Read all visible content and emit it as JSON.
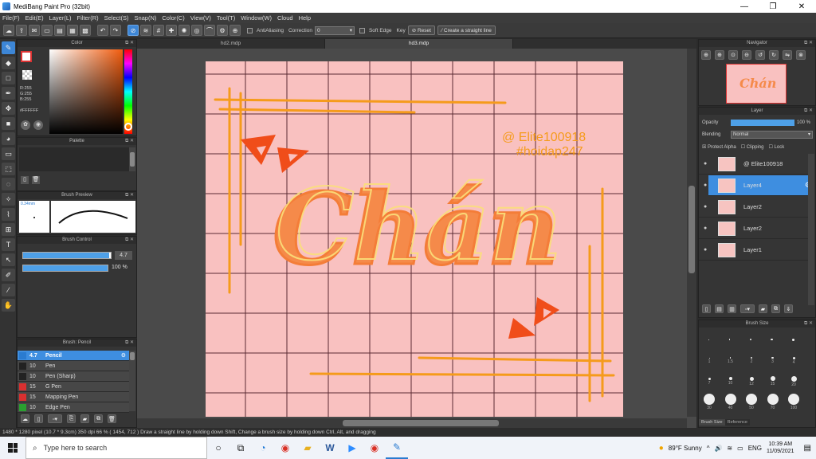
{
  "window": {
    "title": "MediBang Paint Pro (32bit)",
    "min_glyph": "—",
    "max_glyph": "❐",
    "close_glyph": "✕"
  },
  "menu": [
    "File(F)",
    "Edit(E)",
    "Layer(L)",
    "Filter(R)",
    "Select(S)",
    "Snap(N)",
    "Color(C)",
    "View(V)",
    "Tool(T)",
    "Window(W)",
    "Cloud",
    "Help"
  ],
  "toolbar": {
    "antialias_label": "AntiAliasing",
    "correction_label": "Correction",
    "correction_value": "0",
    "soft_edge_label": "Soft Edge",
    "key_label": "Key",
    "reset_label": "Reset",
    "straight_line_label": "Create a straight line"
  },
  "color_panel": {
    "title": "Color",
    "r": "R:255",
    "g": "G:255",
    "b": "B:255",
    "hex": "#FFFFFF"
  },
  "palette_panel": {
    "title": "Palette"
  },
  "brush_preview": {
    "title": "Brush Preview",
    "size": "0.34mm"
  },
  "brush_control": {
    "title": "Brush Control",
    "size_value": "4.7",
    "opacity_value": "100 %",
    "size_fraction": 0.98,
    "opacity_fraction": 1.0
  },
  "brush_list": {
    "title": "Brush: Pencil",
    "items": [
      {
        "size": "4.7",
        "name": "Pencil",
        "color": "#2a7bd0"
      },
      {
        "size": "10",
        "name": "Pen",
        "color": "#222222"
      },
      {
        "size": "10",
        "name": "Pen (Sharp)",
        "color": "#222222"
      },
      {
        "size": "15",
        "name": "G Pen",
        "color": "#d83030"
      },
      {
        "size": "15",
        "name": "Mapping Pen",
        "color": "#d83030"
      },
      {
        "size": "10",
        "name": "Edge Pen",
        "color": "#2aa030"
      }
    ]
  },
  "tabs": [
    "hd2.mdp",
    "hd3.mdp"
  ],
  "artwork": {
    "main_text": "Chán",
    "watermark_line1": "@ Elite100918",
    "watermark_line2": "#hoidap247",
    "colors": {
      "background": "#f9c1c0",
      "grid": "#5a2a33",
      "orange": "#f59b1b",
      "red_orange": "#f04d1a",
      "peach": "#fbbf7a",
      "yellow": "#fbe07a"
    }
  },
  "navigator": {
    "title": "Navigator"
  },
  "layer_panel": {
    "title": "Layer",
    "opacity_label": "Opacity",
    "opacity_value": "100 %",
    "blending_label": "Blending",
    "blending_value": "Normal",
    "protect_alpha": "Protect Alpha",
    "clipping": "Clipping",
    "lock": "Lock",
    "layers": [
      "@ Elite100918",
      "Layer4",
      "Layer2",
      "Layer2",
      "Layer1"
    ]
  },
  "brush_size": {
    "title": "Brush Size",
    "row1": [
      "1",
      "1.5",
      "2",
      "3",
      "4"
    ],
    "row2": [
      "7",
      "10",
      "12",
      "15",
      "20"
    ],
    "row3": [
      "30",
      "40",
      "50",
      "70",
      "100"
    ],
    "tab1": "Brush Size",
    "tab2": "Reference"
  },
  "status": {
    "text": "1480 * 1280 pixel   (10.7 * 9.3cm)   350 dpi   66 %   ( 1454, 712 )   Draw a straight line by holding down Shift, Change a brush size by holding down Ctrl, Alt, and dragging"
  },
  "taskbar": {
    "search_placeholder": "Type here to search",
    "weather": "89°F  Sunny",
    "lang": "ENG",
    "time": "10:39 AM",
    "date": "11/09/2021"
  }
}
